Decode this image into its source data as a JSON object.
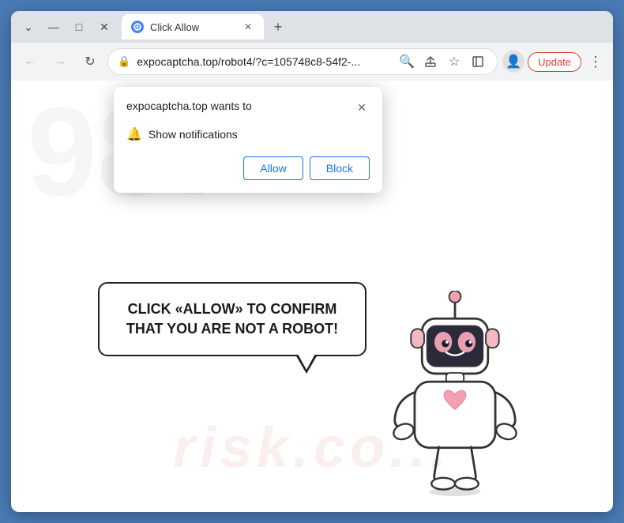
{
  "window": {
    "title": "Click Allow",
    "favicon": "C"
  },
  "titlebar": {
    "minimize": "—",
    "maximize": "□",
    "close": "✕",
    "chevron_down": "⌄",
    "new_tab": "+"
  },
  "tab": {
    "title": "Click Allow",
    "close": "✕"
  },
  "navbar": {
    "back": "←",
    "forward": "→",
    "refresh": "↻",
    "url": "expocaptcha.top/robot4/?c=105748c8-54f2-...",
    "search_icon": "🔍",
    "share_icon": "⬆",
    "bookmark_icon": "☆",
    "sidebar_icon": "▣",
    "profile_icon": "👤",
    "update_label": "Update",
    "menu_icon": "⋮"
  },
  "notification_popup": {
    "title": "expocaptcha.top wants to",
    "close": "✕",
    "notification_label": "Show notifications",
    "allow_label": "Allow",
    "block_label": "Block"
  },
  "speech_bubble": {
    "text": "CLICK «ALLOW» TO CONFIRM THAT YOU ARE NOT A ROBOT!"
  },
  "watermark": {
    "text": "risk.co..."
  },
  "colors": {
    "browser_border": "#4a7ab5",
    "tab_bg": "#fff",
    "nav_bg": "#f1f3f4",
    "titlebar_bg": "#dee1e6",
    "update_color": "#db4437",
    "allow_color": "#1a73e8",
    "block_color": "#1a73e8"
  }
}
